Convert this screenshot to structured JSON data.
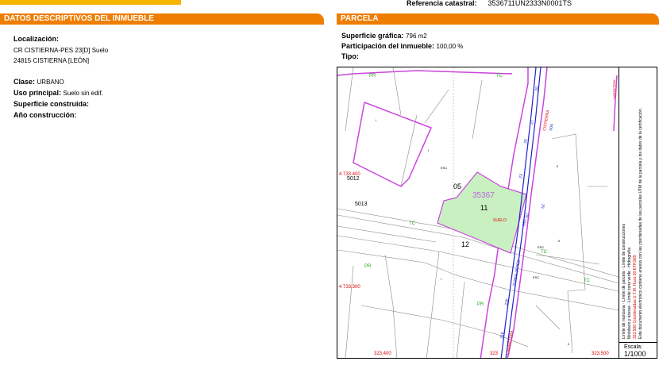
{
  "header": {
    "ref_label": "Referencia catastral:",
    "ref_value": "3536711UN2333N0001TS"
  },
  "left": {
    "title_prefix": "DATOS DESCRIPTIVOS DEL",
    "title_bold": "INMUEBLE",
    "localizacion_label": "Localización:",
    "address_line1": "CR CISTIERNA-PES 23[D] Suelo",
    "address_line2": "24815 CISTIERNA [LEÓN]",
    "clase_label": "Clase:",
    "clase_value": "URBANO",
    "uso_label": "Uso principal:",
    "uso_value": "Suelo sin edif.",
    "superficie_construida_label": "Superficie construida:",
    "ano_label": "Año construcción:"
  },
  "right": {
    "title": "PARCELA",
    "superficie_label": "Superficie gráfica:",
    "superficie_value": "796 m2",
    "participacion_label": "Participación del inmueble:",
    "participacion_value": "100,00 %",
    "tipo_label": "Tipo:"
  },
  "map": {
    "parcel_ref": "35367",
    "parcel_number": "11",
    "suelo": "SUELO",
    "labels": [
      "05",
      "12",
      "5012",
      "5013"
    ],
    "green_labels": [
      "PR",
      "TC",
      "TC",
      "PR",
      "PR",
      "TC",
      "TC"
    ],
    "small_labels": [
      "ESC",
      "ESC",
      "ESC",
      "I",
      "I",
      "II",
      "II",
      "I",
      "II"
    ],
    "road_labels": [
      "29",
      "27",
      "25",
      "23",
      "50A",
      "52",
      "50",
      "DEL",
      "CISTIERNA",
      "2ª PES-2ª PED",
      "22E",
      "31E",
      "CARRETERA"
    ],
    "coords": {
      "y1": "4 733.400",
      "y2": "4 733.300",
      "x1": "323.400",
      "x2": "323.500",
      "x_partial": "323"
    },
    "street_top": "CARRETERA",
    "legend_line1": "Límite de manzana",
    "legend_line2": "Límite de parcela",
    "legend_line3": "Límite de construcciones",
    "legend_line4": "Mobiliario y aceras",
    "legend_line5": "Límite zona verde",
    "legend_line6": "Hidrografía",
    "legend_red": "323.500 Coordenadas U.T.M. Huso 30 ETRS89",
    "legend_note": "Este documento electrónico contiene anexos con las coordenadas de las parcelas UTM de la parcela y los datos de la certificación.",
    "escala_label": "Escala:",
    "escala_value": "1/1000"
  },
  "colors": {
    "orange": "#ef7d00",
    "yellow": "#f7b500",
    "purple": "#cc44dd",
    "road_blue": "#2222cc",
    "green_fill": "#c8f0c0",
    "label_green": "#22aa22",
    "coord_red": "#dd0000"
  }
}
